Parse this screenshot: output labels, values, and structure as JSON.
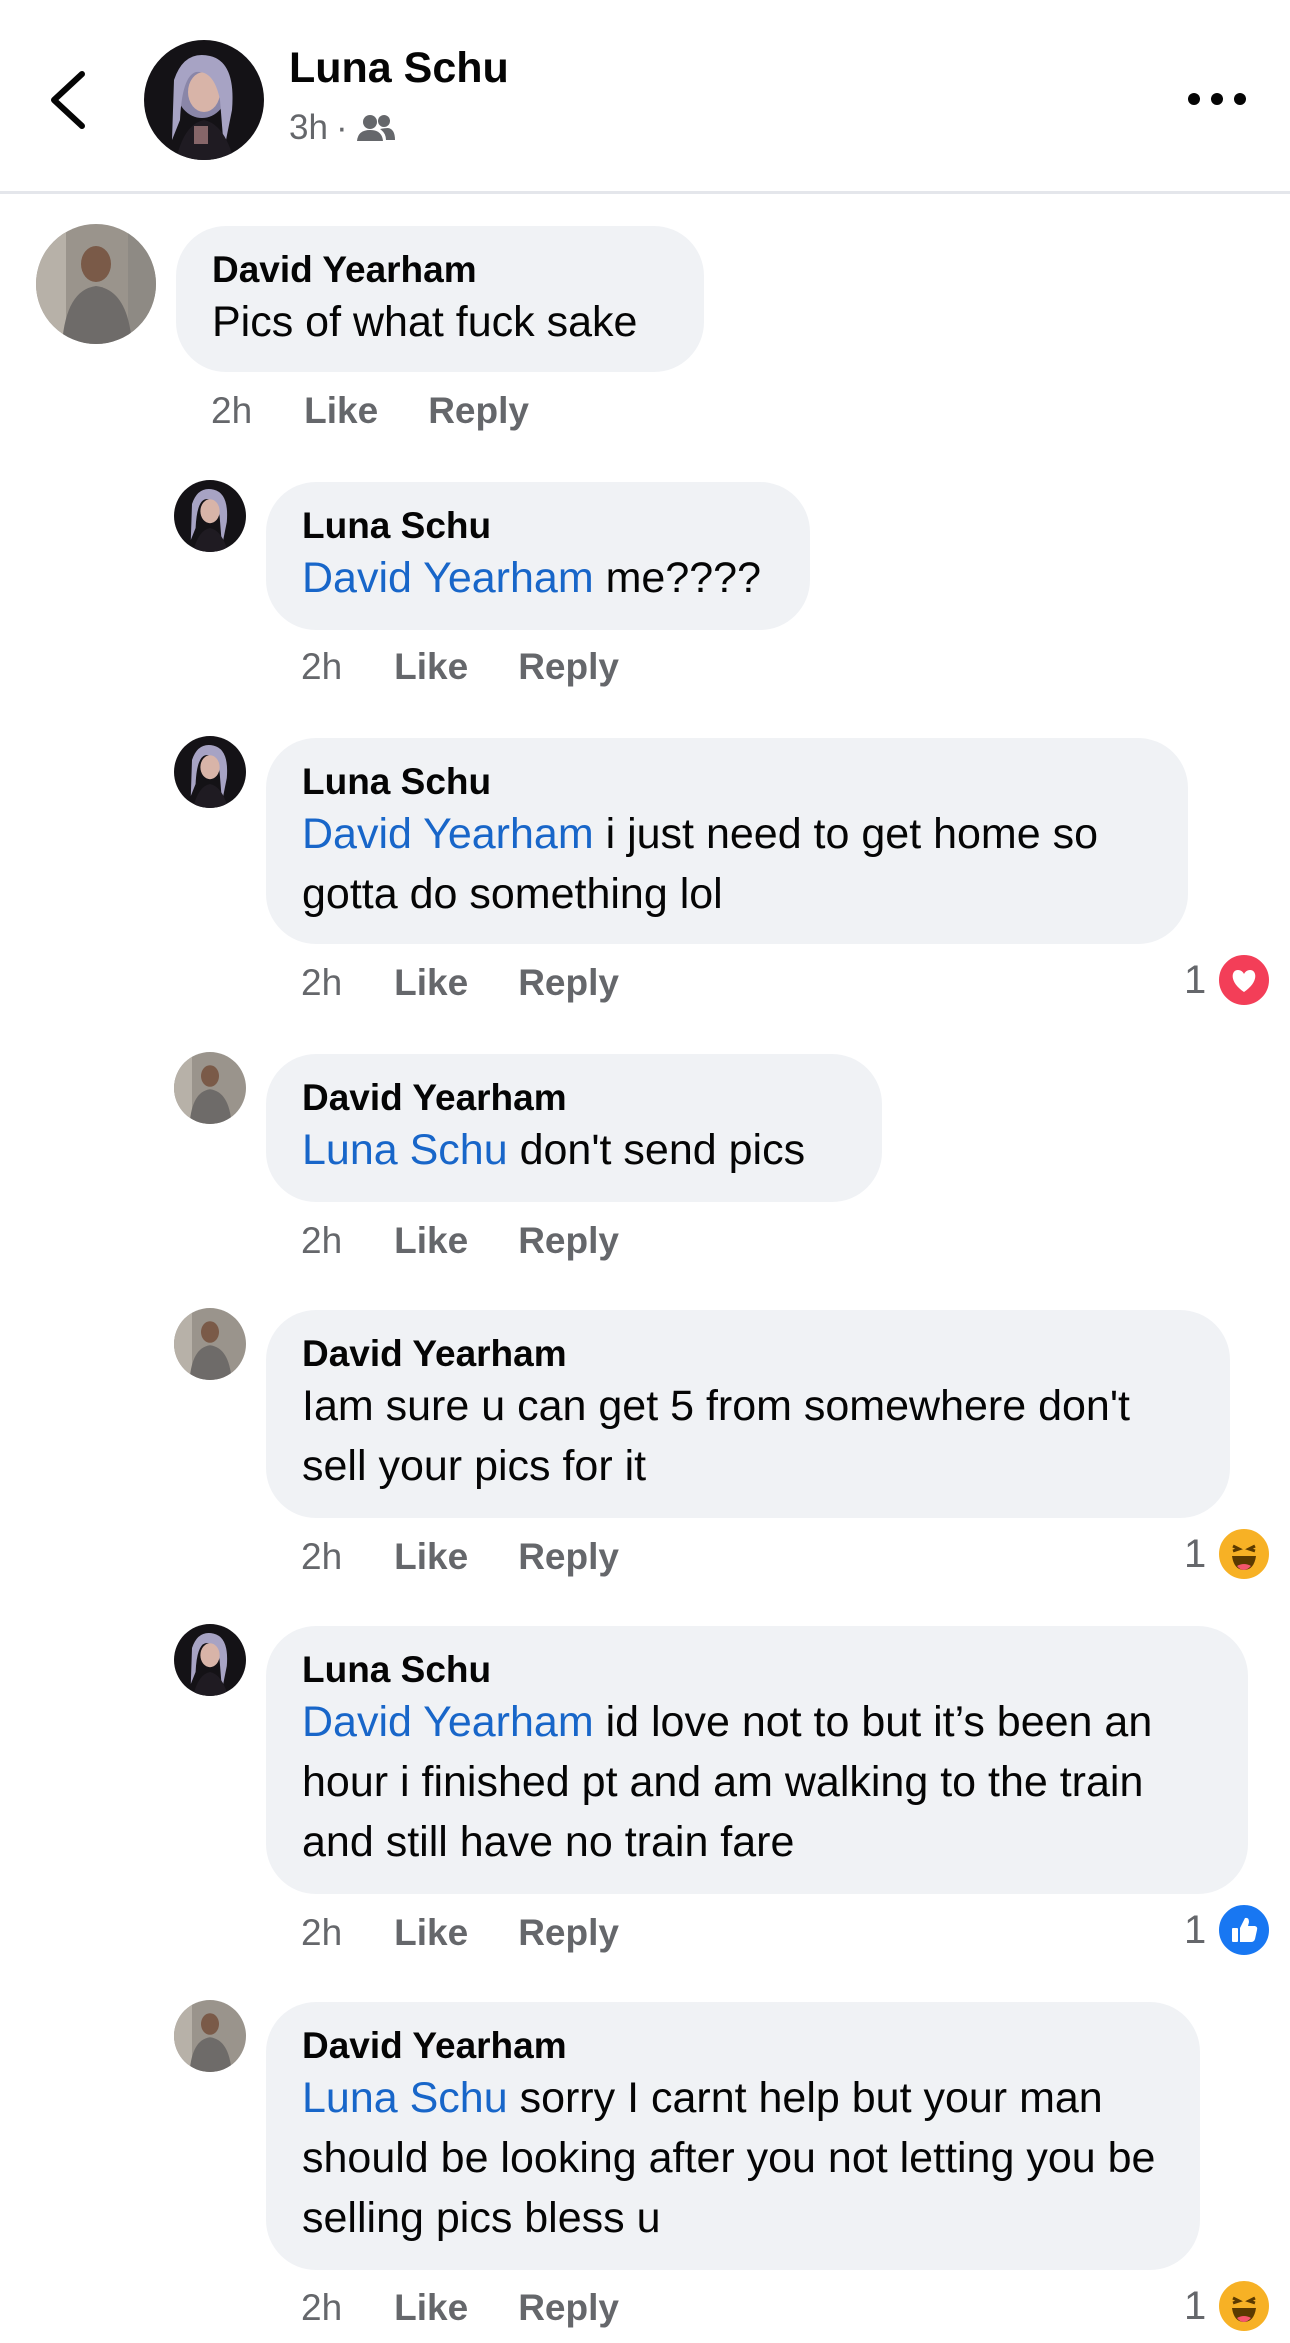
{
  "header": {
    "author": "Luna Schu",
    "time": "3h",
    "separator": "·",
    "audience_icon": "friends-icon",
    "back_icon": "chevron-left-icon",
    "more_icon": "more-horizontal-icon"
  },
  "colors": {
    "mention": "#1866c9",
    "bubble": "#f0f2f5",
    "meta": "#65676b",
    "heart": "#f33e58",
    "like": "#1877f2",
    "haha": "#f7b125"
  },
  "comments": [
    {
      "author": "David Yearham",
      "mention": "",
      "text": "Pics of what fuck sake",
      "time": "2h",
      "like": "Like",
      "reply": "Reply",
      "reaction_count": "",
      "reaction": ""
    },
    {
      "author": "Luna Schu",
      "mention": "David Yearham",
      "text": " me????",
      "time": "2h",
      "like": "Like",
      "reply": "Reply",
      "reaction_count": "",
      "reaction": ""
    },
    {
      "author": "Luna Schu",
      "mention": "David Yearham",
      "text": " i just need to get home so gotta do something lol",
      "time": "2h",
      "like": "Like",
      "reply": "Reply",
      "reaction_count": "1",
      "reaction": "heart"
    },
    {
      "author": "David Yearham",
      "mention": "Luna Schu",
      "text": " don't send pics",
      "time": "2h",
      "like": "Like",
      "reply": "Reply",
      "reaction_count": "",
      "reaction": ""
    },
    {
      "author": "David Yearham",
      "mention": "",
      "text": "Iam sure u can get 5 from somewhere don't sell your pics for it",
      "time": "2h",
      "like": "Like",
      "reply": "Reply",
      "reaction_count": "1",
      "reaction": "haha"
    },
    {
      "author": "Luna Schu",
      "mention": "David Yearham",
      "text": " id love not to but it’s been an hour i finished pt and am walking to the train and still have no train fare",
      "time": "2h",
      "like": "Like",
      "reply": "Reply",
      "reaction_count": "1",
      "reaction": "like"
    },
    {
      "author": "David Yearham",
      "mention": "Luna Schu",
      "text": " sorry I carnt help but your man should be looking after you not letting you be selling pics bless u",
      "time": "2h",
      "like": "Like",
      "reply": "Reply",
      "reaction_count": "1",
      "reaction": "haha"
    }
  ]
}
